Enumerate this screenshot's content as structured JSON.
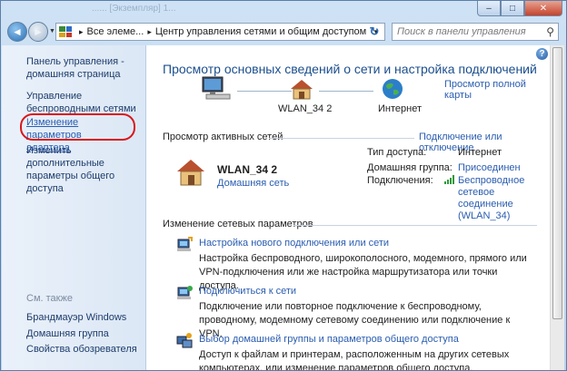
{
  "window": {
    "faint_title": "...... [Экземпляр] 1...",
    "buttons": {
      "minimize": "–",
      "maximize": "□",
      "close": "✕"
    }
  },
  "address_bar": {
    "segments": [
      "Все элеме...",
      "Центр управления сетями и общим доступом"
    ],
    "separator": "▸"
  },
  "search": {
    "placeholder": "Поиск в панели управления"
  },
  "sidebar": {
    "home": "Панель управления - домашняя страница",
    "links": [
      "Управление беспроводными сетями",
      "Изменение параметров адаптера",
      "Изменить дополнительные параметры общего доступа"
    ],
    "see_also_title": "См. также",
    "see_also": [
      "Брандмауэр Windows",
      "Домашняя группа",
      "Свойства обозревателя"
    ]
  },
  "main": {
    "title": "Просмотр основных сведений о сети и настройка подключений",
    "full_map_link": "Просмотр полной карты",
    "map": {
      "network_label": "WLAN_34  2",
      "internet_label": "Интернет"
    },
    "active_networks": {
      "header": "Просмотр активных сетей",
      "connect_link": "Подключение или отключение",
      "network_name": "WLAN_34  2",
      "network_type": "Домашняя сеть",
      "access_type_label": "Тип доступа:",
      "access_type_value": "Интернет",
      "homegroup_label": "Домашняя группа:",
      "homegroup_value": "Присоединен",
      "connections_label": "Подключения:",
      "connection_value": "Беспроводное сетевое соединение (WLAN_34)"
    },
    "change_settings": {
      "header": "Изменение сетевых параметров",
      "tasks": [
        {
          "title": "Настройка нового подключения или сети",
          "desc": "Настройка беспроводного, широкополосного, модемного, прямого или VPN-подключения или же настройка маршрутизатора или точки доступа."
        },
        {
          "title": "Подключиться к сети",
          "desc": "Подключение или повторное подключение к беспроводному, проводному, модемному сетевому соединению или подключение к VPN."
        },
        {
          "title": "Выбор домашней группы и параметров общего доступа",
          "desc": "Доступ к файлам и принтерам, расположенным на других сетевых компьютерах, или изменение параметров общего доступа."
        }
      ]
    }
  },
  "colors": {
    "link": "#2a5db0",
    "title": "#1c4f8e",
    "highlight_circle": "#d9151b"
  }
}
